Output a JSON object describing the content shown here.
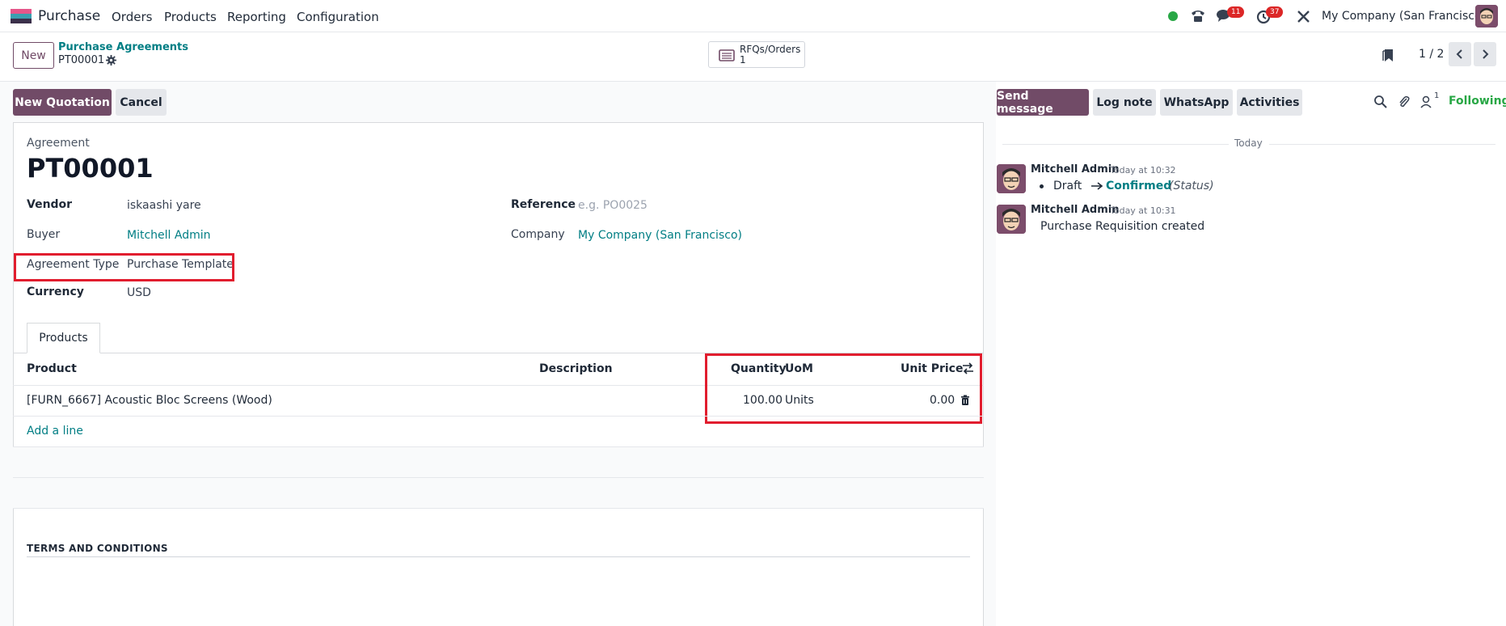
{
  "navbar": {
    "app_name": "Purchase",
    "menu": [
      "Orders",
      "Products",
      "Reporting",
      "Configuration"
    ],
    "messages_badge": "11",
    "activities_badge": "37",
    "company": "My Company (San Francisco)"
  },
  "control_panel": {
    "new_label": "New",
    "breadcrumb_parent": "Purchase Agreements",
    "breadcrumb_current": "PT00001",
    "smart_button": {
      "label": "RFQs/Orders",
      "count": "1"
    },
    "pager": "1 / 2"
  },
  "statusbar": {
    "new_quotation": "New Quotation",
    "cancel": "Cancel"
  },
  "form": {
    "agreement_label": "Agreement",
    "agreement_name": "PT00001",
    "vendor_label": "Vendor",
    "vendor_value": "iskaashi yare",
    "buyer_label": "Buyer",
    "buyer_value": "Mitchell Admin",
    "type_label": "Agreement Type",
    "type_value": "Purchase Template",
    "currency_label": "Currency",
    "currency_value": "USD",
    "reference_label": "Reference",
    "reference_placeholder": "e.g. PO0025",
    "company_label": "Company",
    "company_value": "My Company (San Francisco)",
    "tab_products": "Products",
    "columns": {
      "product": "Product",
      "description": "Description",
      "quantity": "Quantity",
      "uom": "UoM",
      "unit_price": "Unit Price"
    },
    "lines": [
      {
        "product": "[FURN_6667] Acoustic Bloc Screens (Wood)",
        "description": "",
        "quantity": "100.00",
        "uom": "Units",
        "unit_price": "0.00"
      }
    ],
    "add_line": "Add a line",
    "terms": "TERMS AND CONDITIONS"
  },
  "chatter": {
    "send_message": "Send message",
    "log_note": "Log note",
    "whatsapp": "WhatsApp",
    "activities": "Activities",
    "followers_count": "1",
    "following": "Following",
    "today": "Today",
    "messages": [
      {
        "author": "Mitchell Admin",
        "time": "Today at 10:32",
        "from": "Draft",
        "to": "Confirmed",
        "field": "(Status)"
      },
      {
        "author": "Mitchell Admin",
        "time": "Today at 10:31",
        "body": "Purchase Requisition created"
      }
    ]
  },
  "colors": {
    "brand": "#714b67",
    "link": "#017e84",
    "highlight": "#e11d2e",
    "following": "#28a745"
  }
}
